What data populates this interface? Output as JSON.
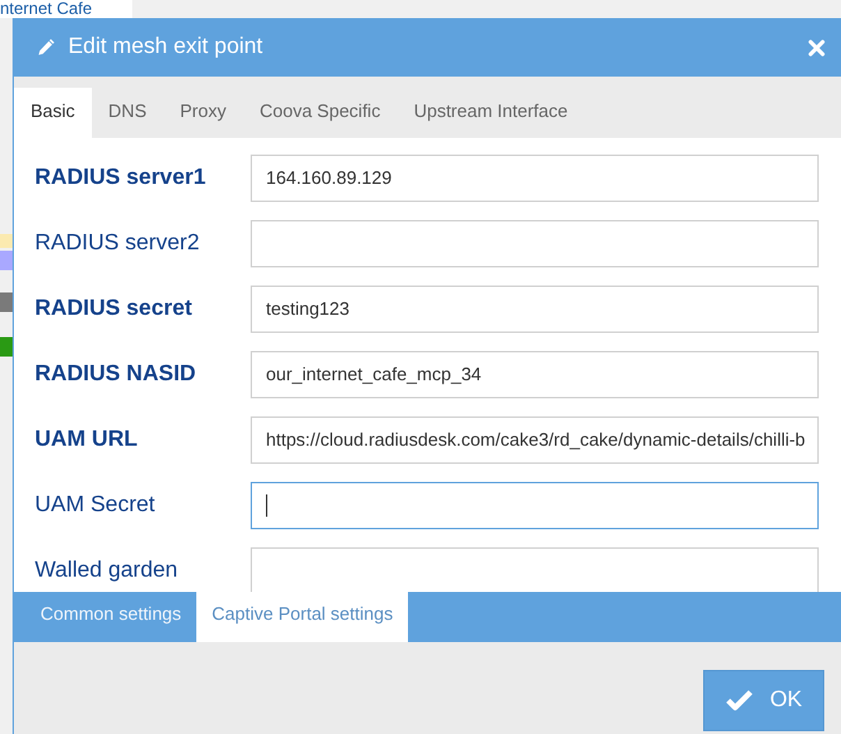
{
  "background_page": {
    "title_fragment": "nternet Cafe"
  },
  "window": {
    "title": "Edit mesh exit point"
  },
  "tabs": [
    {
      "label": "Basic",
      "selected": true
    },
    {
      "label": "DNS",
      "selected": false
    },
    {
      "label": "Proxy",
      "selected": false
    },
    {
      "label": "Coova Specific",
      "selected": false
    },
    {
      "label": "Upstream Interface",
      "selected": false
    }
  ],
  "fields": [
    {
      "label": "RADIUS server1",
      "required": true,
      "value": "164.160.89.129",
      "focused": false
    },
    {
      "label": "RADIUS server2",
      "required": false,
      "focused": false
    },
    {
      "label": "RADIUS secret",
      "required": true,
      "value": "testing123",
      "focused": false
    },
    {
      "label": "RADIUS NASID",
      "required": true,
      "value": "our_internet_cafe_mcp_34",
      "focused": false
    },
    {
      "label": "UAM URL",
      "required": true,
      "value": "https://cloud.radiusdesk.com/cake3/rd_cake/dynamic-details/chilli-b",
      "focused": false
    },
    {
      "label": "UAM Secret",
      "required": false,
      "focused": true
    },
    {
      "label": "Walled garden",
      "required": false,
      "focused": false
    }
  ],
  "bottom_tabs": [
    {
      "label": "Common settings",
      "selected": false
    },
    {
      "label": "Captive Portal settings",
      "selected": true
    }
  ],
  "buttons": [
    {
      "label": "OK"
    }
  ]
}
